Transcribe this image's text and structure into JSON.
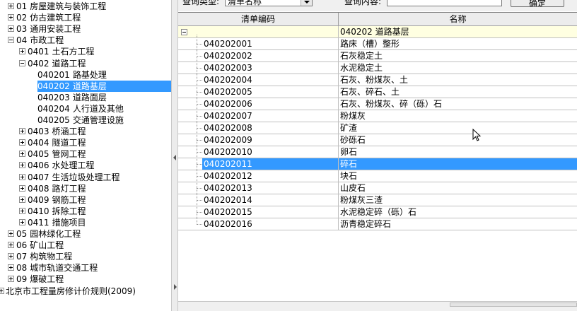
{
  "tree": {
    "nodes": [
      {
        "code": "01",
        "label": "房屋建筑与装饰工程",
        "level": 1,
        "toggle": "plus"
      },
      {
        "code": "02",
        "label": "仿古建筑工程",
        "level": 1,
        "toggle": "plus"
      },
      {
        "code": "03",
        "label": "通用安装工程",
        "level": 1,
        "toggle": "plus"
      },
      {
        "code": "04",
        "label": "市政工程",
        "level": 1,
        "toggle": "minus"
      },
      {
        "code": "0401",
        "label": "土石方工程",
        "level": 2,
        "toggle": "plus"
      },
      {
        "code": "0402",
        "label": "道路工程",
        "level": 2,
        "toggle": "minus"
      },
      {
        "code": "040201",
        "label": "路基处理",
        "level": 3,
        "toggle": "none"
      },
      {
        "code": "040202",
        "label": "道路基层",
        "level": 3,
        "toggle": "none",
        "selected": true
      },
      {
        "code": "040203",
        "label": "道路面层",
        "level": 3,
        "toggle": "none"
      },
      {
        "code": "040204",
        "label": "人行道及其他",
        "level": 3,
        "toggle": "none"
      },
      {
        "code": "040205",
        "label": "交通管理设施",
        "level": 3,
        "toggle": "none"
      },
      {
        "code": "0403",
        "label": "桥涵工程",
        "level": 2,
        "toggle": "plus"
      },
      {
        "code": "0404",
        "label": "隧道工程",
        "level": 2,
        "toggle": "plus"
      },
      {
        "code": "0405",
        "label": "管网工程",
        "level": 2,
        "toggle": "plus"
      },
      {
        "code": "0406",
        "label": "水处理工程",
        "level": 2,
        "toggle": "plus"
      },
      {
        "code": "0407",
        "label": "生活垃圾处理工程",
        "level": 2,
        "toggle": "plus"
      },
      {
        "code": "0408",
        "label": "路灯工程",
        "level": 2,
        "toggle": "plus"
      },
      {
        "code": "0409",
        "label": "钢筋工程",
        "level": 2,
        "toggle": "plus"
      },
      {
        "code": "0410",
        "label": "拆除工程",
        "level": 2,
        "toggle": "plus"
      },
      {
        "code": "0411",
        "label": "措施项目",
        "level": 2,
        "toggle": "plus"
      },
      {
        "code": "05",
        "label": "园林绿化工程",
        "level": 1,
        "toggle": "plus"
      },
      {
        "code": "06",
        "label": "矿山工程",
        "level": 1,
        "toggle": "plus"
      },
      {
        "code": "07",
        "label": "构筑物工程",
        "level": 1,
        "toggle": "plus"
      },
      {
        "code": "08",
        "label": "城市轨道交通工程",
        "level": 1,
        "toggle": "plus"
      },
      {
        "code": "09",
        "label": "爆破工程",
        "level": 1,
        "toggle": "plus"
      },
      {
        "code": "",
        "label": "北京市工程量房修计价规则(2009)",
        "level": 0,
        "toggle": "plus"
      }
    ]
  },
  "toolbar": {
    "query_type_label": "查询类型:",
    "query_type_value": "清单名称",
    "query_content_label": "查询内容:",
    "confirm_label": "确定"
  },
  "grid": {
    "columns": [
      "清单编码",
      "名称"
    ],
    "parent": {
      "code": "",
      "name": "040202  道路基层"
    },
    "rows": [
      {
        "code": "040202001",
        "name": "路床（槽）整形"
      },
      {
        "code": "040202002",
        "name": "石灰稳定土"
      },
      {
        "code": "040202003",
        "name": "水泥稳定土"
      },
      {
        "code": "040202004",
        "name": "石灰、粉煤灰、土"
      },
      {
        "code": "040202005",
        "name": "石灰、碎石、土"
      },
      {
        "code": "040202006",
        "name": "石灰、粉煤灰、碎（砾）石"
      },
      {
        "code": "040202007",
        "name": "粉煤灰"
      },
      {
        "code": "040202008",
        "name": "矿渣"
      },
      {
        "code": "040202009",
        "name": "砂砾石"
      },
      {
        "code": "040202010",
        "name": "卵石"
      },
      {
        "code": "040202011",
        "name": "碎石",
        "selected": true
      },
      {
        "code": "040202012",
        "name": "块石"
      },
      {
        "code": "040202013",
        "name": "山皮石"
      },
      {
        "code": "040202014",
        "name": "粉煤灰三渣"
      },
      {
        "code": "040202015",
        "name": "水泥稳定碎（砾）石"
      },
      {
        "code": "040202016",
        "name": "沥青稳定碎石"
      }
    ]
  },
  "colors": {
    "selection": "#3399ff",
    "parent_row": "#ffffe1"
  }
}
